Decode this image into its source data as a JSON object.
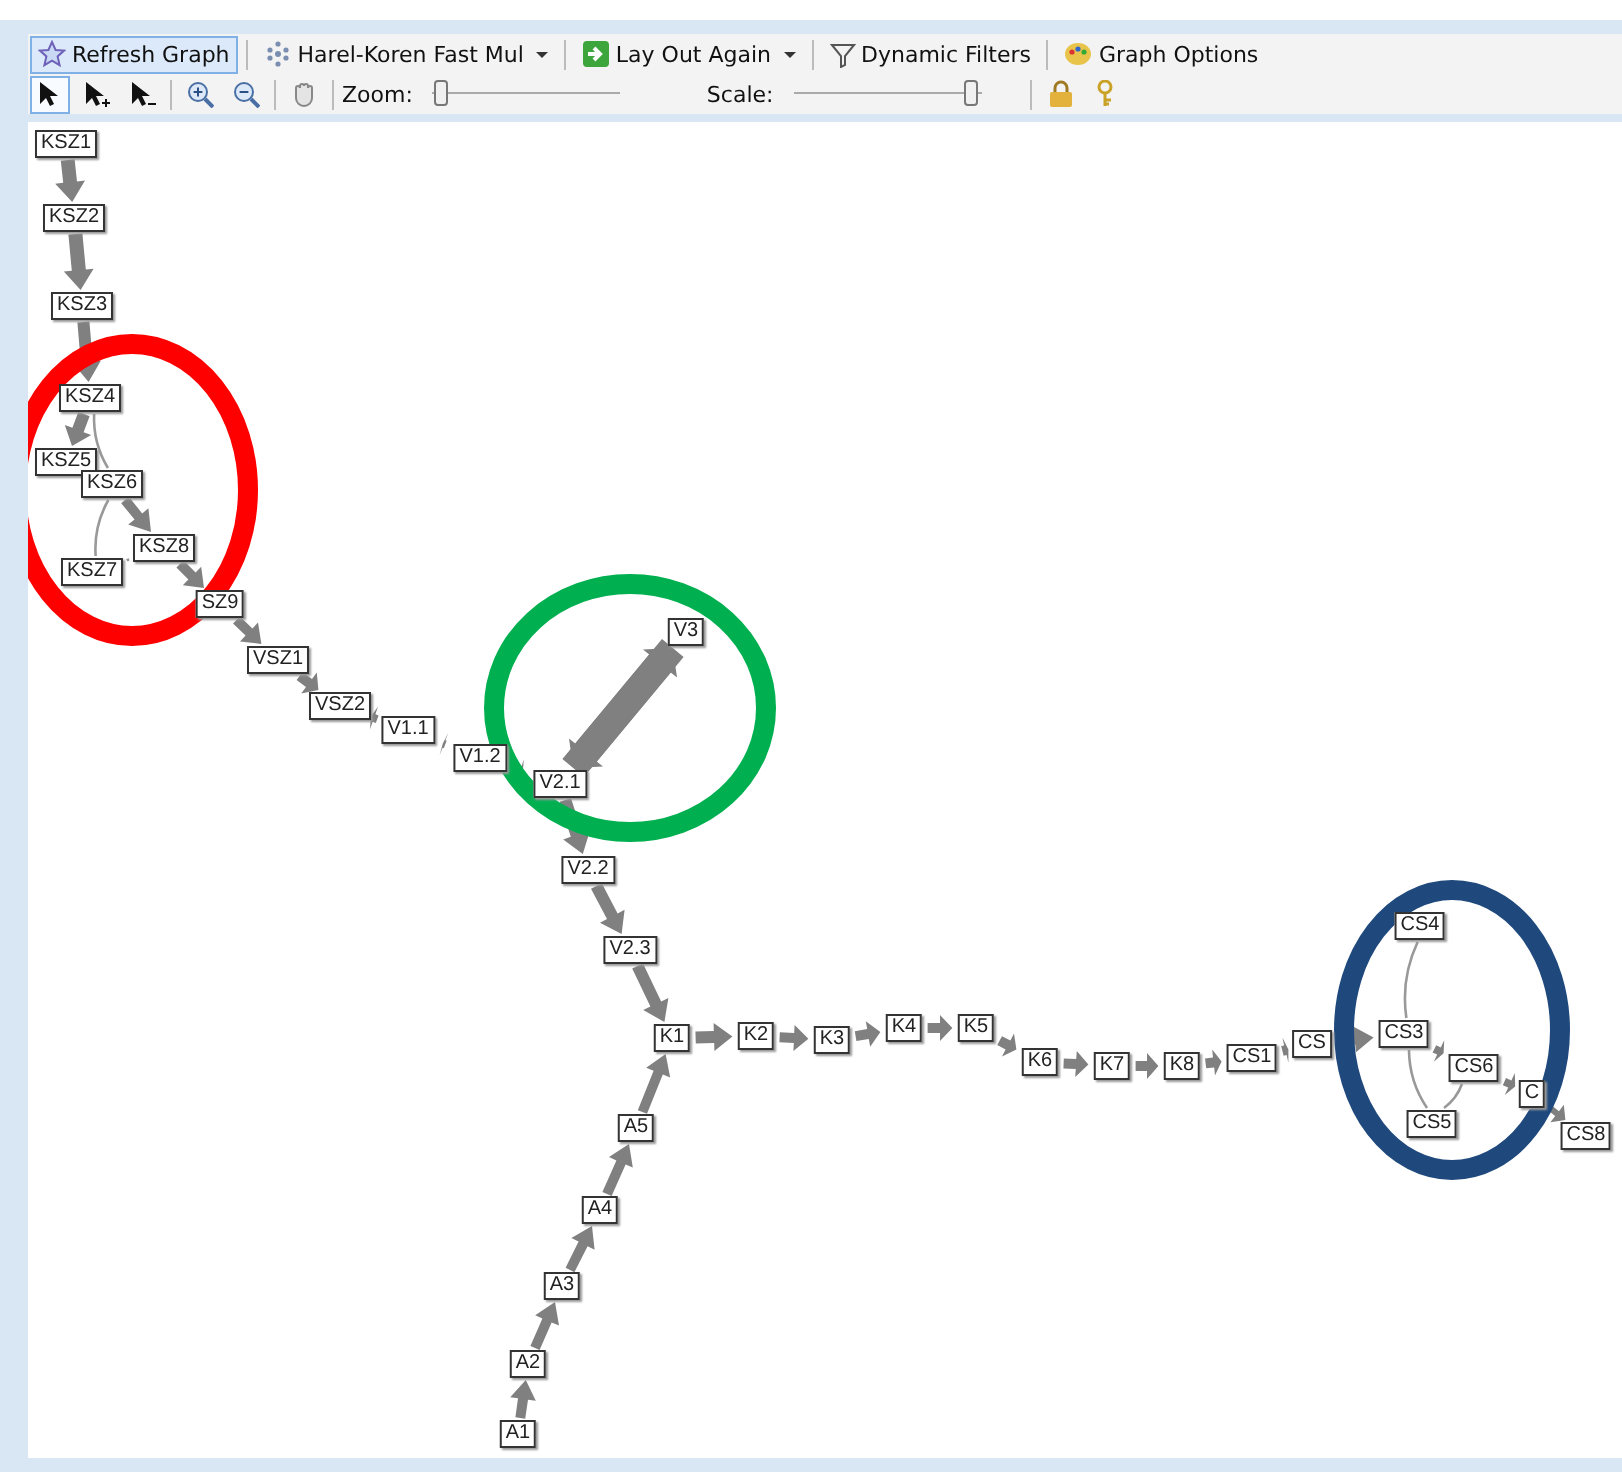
{
  "toolbar": {
    "buttons": [
      {
        "kind": "refresh",
        "label": "Refresh Graph",
        "highlighted": true
      },
      {
        "kind": "layout-dropdown",
        "label": "Harel-Koren Fast Mul",
        "highlighted": false
      },
      {
        "kind": "split",
        "label": "Lay Out Again",
        "highlighted": false
      },
      {
        "kind": "filter",
        "label": "Dynamic Filters",
        "highlighted": false
      },
      {
        "kind": "options",
        "label": "Graph Options",
        "highlighted": false
      }
    ],
    "tools": [
      {
        "kind": "pointer",
        "selected": true
      },
      {
        "kind": "pointer-plus",
        "selected": false
      },
      {
        "kind": "pointer-minus",
        "selected": false
      },
      {
        "kind": "zoom-in",
        "selected": false
      },
      {
        "kind": "zoom-out",
        "selected": false
      },
      {
        "kind": "pan",
        "selected": false
      }
    ],
    "sliders": [
      {
        "label": "Zoom:",
        "level": 0.03
      },
      {
        "label": "Scale:",
        "level": 0.97
      }
    ],
    "extras": [
      {
        "kind": "lock"
      },
      {
        "kind": "key"
      }
    ]
  },
  "graph": {
    "nodes": [
      {
        "label": "KSZ1"
      },
      {
        "label": "KSZ2"
      },
      {
        "label": "KSZ3"
      },
      {
        "label": "KSZ4"
      },
      {
        "label": "KSZ5"
      },
      {
        "label": "KSZ6"
      },
      {
        "label": "KSZ8"
      },
      {
        "label": "KSZ7"
      },
      {
        "label": "SZ9"
      },
      {
        "label": "VSZ1"
      },
      {
        "label": "VSZ2"
      },
      {
        "label": "V1.1"
      },
      {
        "label": "V1.2"
      },
      {
        "label": "V2.1"
      },
      {
        "label": "V3"
      },
      {
        "label": "V2.2"
      },
      {
        "label": "V2.3"
      },
      {
        "label": "K1"
      },
      {
        "label": "K2"
      },
      {
        "label": "K3"
      },
      {
        "label": "K4"
      },
      {
        "label": "K5"
      },
      {
        "label": "K6"
      },
      {
        "label": "K7"
      },
      {
        "label": "K8"
      },
      {
        "label": "CS1"
      },
      {
        "label": "CS"
      },
      {
        "label": "CS3"
      },
      {
        "label": "CS4"
      },
      {
        "label": "CS6"
      },
      {
        "label": "CS5"
      },
      {
        "label": "C"
      },
      {
        "label": "CS8"
      },
      {
        "label": "A5"
      },
      {
        "label": "A4"
      },
      {
        "label": "A3"
      },
      {
        "label": "A2"
      },
      {
        "label": "A1"
      }
    ],
    "highlights": [
      {
        "color": "#ff0000"
      },
      {
        "color": "#00b050"
      },
      {
        "color": "#1f497d"
      }
    ]
  }
}
